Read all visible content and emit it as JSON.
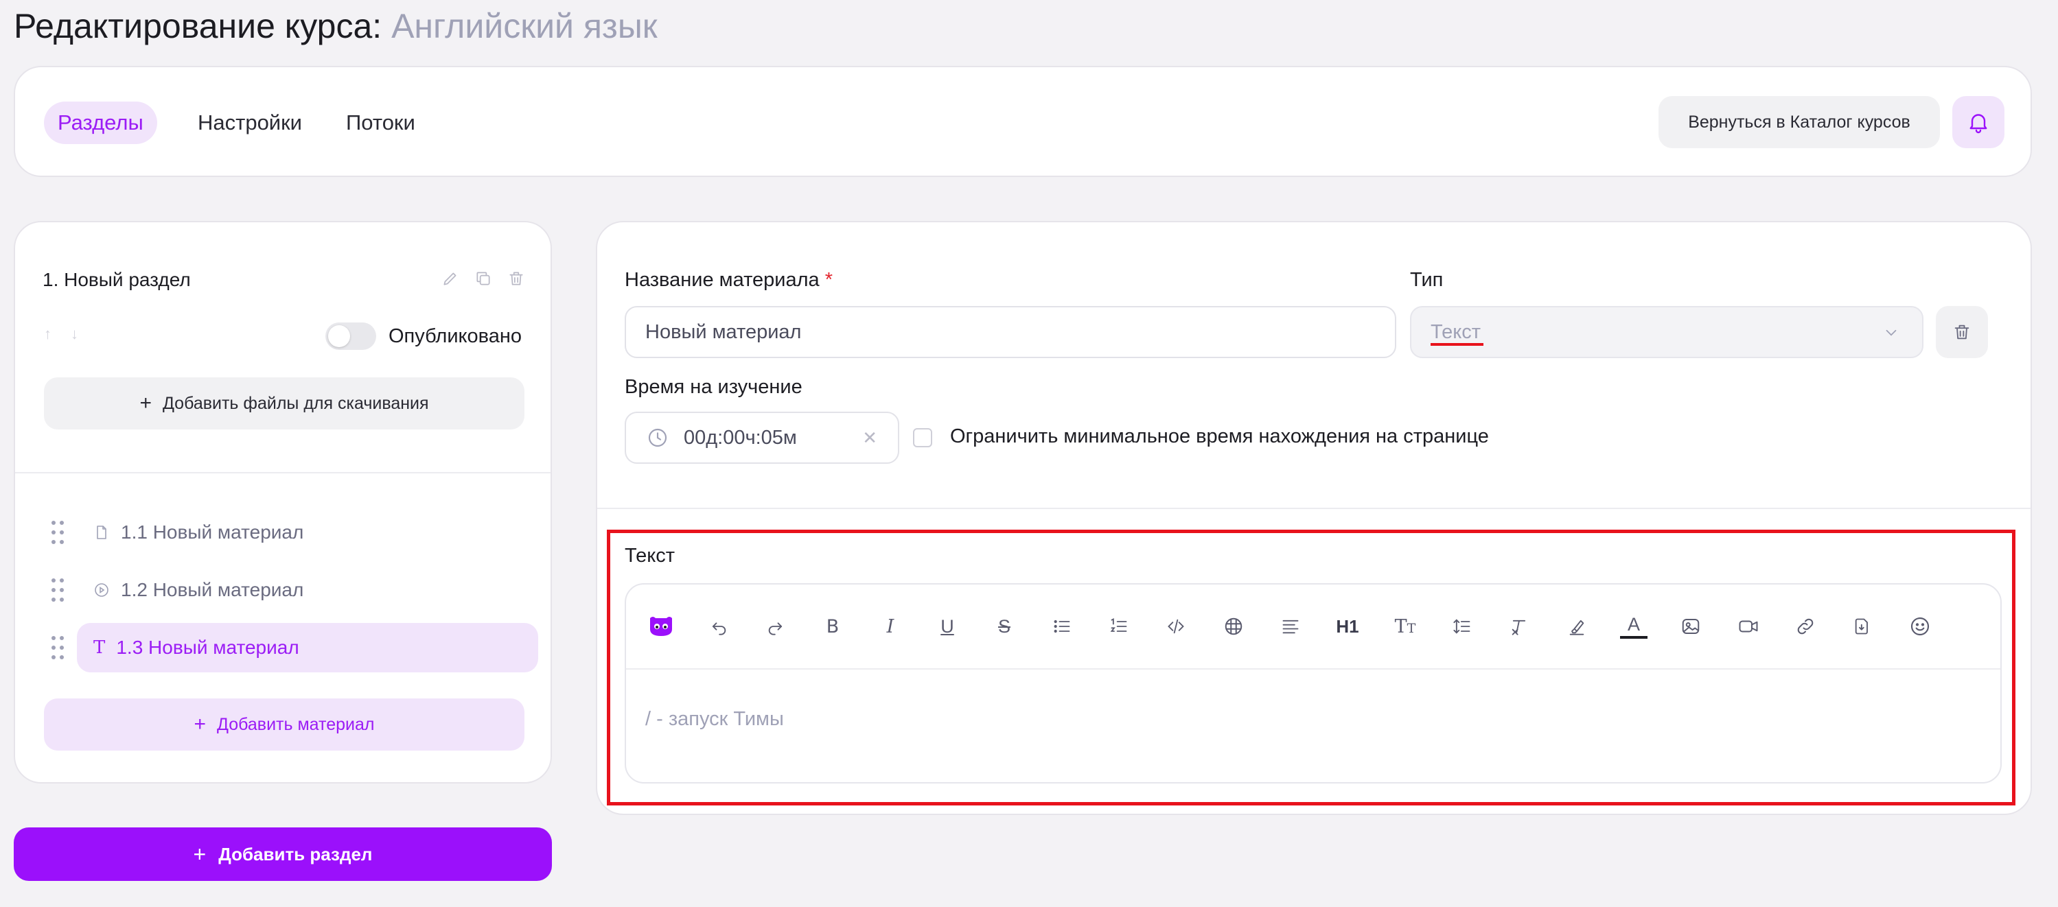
{
  "page": {
    "title_prefix": "Редактирование курса:",
    "title_course": "Английский язык"
  },
  "tabs": [
    {
      "label": "Разделы",
      "active": true
    },
    {
      "label": "Настройки",
      "active": false
    },
    {
      "label": "Потоки",
      "active": false
    }
  ],
  "header": {
    "back_label": "Вернуться в Каталог курсов",
    "bell_icon": "bell-icon"
  },
  "section": {
    "title": "1. Новый раздел",
    "published_label": "Опубликовано",
    "published": false,
    "add_files_label": "Добавить файлы для скачивания",
    "materials": [
      {
        "label": "1.1 Новый материал",
        "icon": "file-icon",
        "active": false
      },
      {
        "label": "1.2 Новый материал",
        "icon": "play-icon",
        "active": false
      },
      {
        "label": "1.3 Новый материал",
        "icon": "text-icon",
        "active": true
      }
    ],
    "add_material_label": "Добавить материал"
  },
  "add_section_label": "Добавить раздел",
  "material": {
    "name_label": "Название материала",
    "name_required": "*",
    "name_value": "Новый материал",
    "type_label": "Тип",
    "type_value": "Текст",
    "time_label": "Время на изучение",
    "time_value": "00д:00ч:05м",
    "limit_label": "Ограничить минимальное время нахождения на странице",
    "limit_checked": false,
    "editor_label": "Текст",
    "editor_placeholder": "/ - запуск Тимы",
    "toolbar_h1": "H1"
  },
  "colors": {
    "accent": "#9b10fb",
    "accent_light": "#f1e4fb",
    "highlight_red": "#e8121c",
    "muted": "#9fa1b6"
  }
}
